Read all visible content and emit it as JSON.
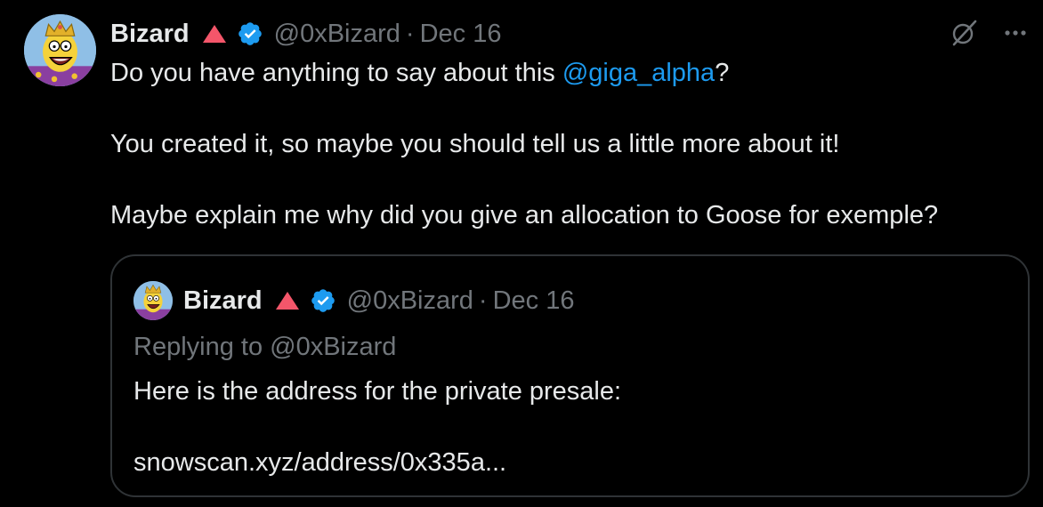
{
  "tweet": {
    "author": {
      "name": "Bizard",
      "handle": "@0xBizard",
      "separator": "·",
      "date": "Dec 16"
    },
    "icons": {
      "badge": "red-triangle-icon",
      "verified": "verified-badge-icon",
      "grok": "grok-icon",
      "more": "more-options-icon"
    },
    "colors": {
      "background": "#000000",
      "text": "#e7e9ea",
      "muted": "#71767b",
      "link": "#1d9bf0",
      "badge_red": "#f4566a",
      "border": "#2f3336"
    },
    "body": {
      "line1_prefix": "Do you have anything to say about this ",
      "line1_mention": "@giga_alpha",
      "line1_suffix": "?",
      "line2": "You created it, so maybe you should tell us a little more about it!",
      "line3": "Maybe explain me why did you give an allocation to Goose for exemple?"
    }
  },
  "quote": {
    "author": {
      "name": "Bizard",
      "handle": "@0xBizard",
      "separator": "·",
      "date": "Dec 16"
    },
    "replying_to": "Replying to @0xBizard",
    "line1": "Here is the address for the private presale:",
    "line2": "snowscan.xyz/address/0x335a..."
  }
}
